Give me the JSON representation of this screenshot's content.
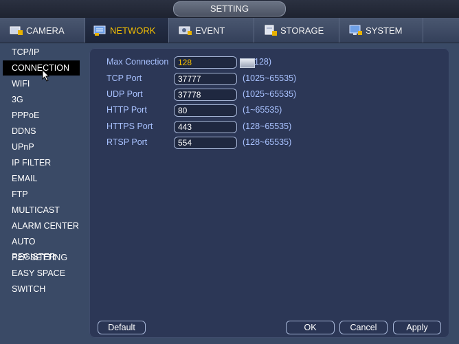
{
  "window": {
    "title": "SETTING"
  },
  "tabs": [
    {
      "label": "CAMERA",
      "icon": "camera-icon"
    },
    {
      "label": "NETWORK",
      "icon": "network-icon",
      "active": true
    },
    {
      "label": "EVENT",
      "icon": "event-icon"
    },
    {
      "label": "STORAGE",
      "icon": "storage-icon"
    },
    {
      "label": "SYSTEM",
      "icon": "system-icon"
    }
  ],
  "sidebar": {
    "items": [
      {
        "label": "TCP/IP"
      },
      {
        "label": "CONNECTION",
        "active": true
      },
      {
        "label": "WIFI"
      },
      {
        "label": "3G"
      },
      {
        "label": "PPPoE"
      },
      {
        "label": "DDNS"
      },
      {
        "label": "UPnP"
      },
      {
        "label": "IP FILTER"
      },
      {
        "label": "EMAIL"
      },
      {
        "label": "FTP"
      },
      {
        "label": "MULTICAST"
      },
      {
        "label": "ALARM CENTER"
      },
      {
        "label": "AUTO REGISTER"
      },
      {
        "label": "P2P SETTING"
      },
      {
        "label": "EASY SPACE"
      },
      {
        "label": "SWITCH"
      }
    ]
  },
  "form": {
    "max_connection": {
      "label": "Max Connection",
      "value": "128",
      "range": "128)"
    },
    "tcp_port": {
      "label": "TCP Port",
      "value": "37777",
      "range": "(1025~65535)"
    },
    "udp_port": {
      "label": "UDP Port",
      "value": "37778",
      "range": "(1025~65535)"
    },
    "http_port": {
      "label": "HTTP Port",
      "value": "80",
      "range": "(1~65535)"
    },
    "https_port": {
      "label": "HTTPS Port",
      "value": "443",
      "range": "(128~65535)"
    },
    "rtsp_port": {
      "label": "RTSP Port",
      "value": "554",
      "range": "(128~65535)"
    }
  },
  "buttons": {
    "default": "Default",
    "ok": "OK",
    "cancel": "Cancel",
    "apply": "Apply"
  },
  "colors": {
    "active_tab_text": "#f6c000",
    "label_text": "#a9c2ff",
    "panel_bg": "#2c3756",
    "page_bg": "#3a4a66"
  }
}
